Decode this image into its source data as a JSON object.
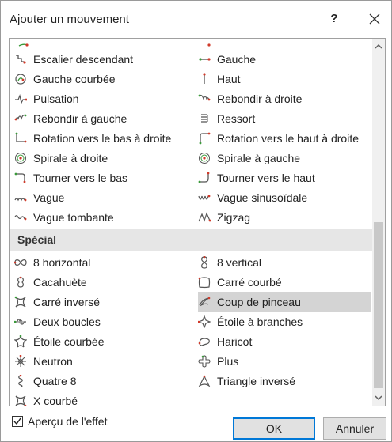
{
  "dialog": {
    "title": "Ajouter un mouvement",
    "help_label": "?",
    "close_icon": "close-icon"
  },
  "list": {
    "rows_before": [
      {
        "left": {
          "label": "Escalier descendant",
          "icon": "stairs-down-icon"
        },
        "right": {
          "label": "Gauche",
          "icon": "arrow-left-icon"
        }
      },
      {
        "left": {
          "label": "Gauche courbée",
          "icon": "curved-left-icon"
        },
        "right": {
          "label": "Haut",
          "icon": "arrow-up-icon"
        }
      },
      {
        "left": {
          "label": "Pulsation",
          "icon": "pulse-icon"
        },
        "right": {
          "label": "Rebondir à droite",
          "icon": "bounce-right-icon"
        }
      },
      {
        "left": {
          "label": "Rebondir à gauche",
          "icon": "bounce-left-icon"
        },
        "right": {
          "label": "Ressort",
          "icon": "spring-icon"
        }
      },
      {
        "left": {
          "label": "Rotation vers le bas à droite",
          "icon": "turn-down-right-icon"
        },
        "right": {
          "label": "Rotation vers le haut à droite",
          "icon": "turn-up-right-icon"
        }
      },
      {
        "left": {
          "label": "Spirale à droite",
          "icon": "spiral-right-icon"
        },
        "right": {
          "label": "Spirale à gauche",
          "icon": "spiral-left-icon"
        }
      },
      {
        "left": {
          "label": "Tourner vers le bas",
          "icon": "turn-down-icon"
        },
        "right": {
          "label": "Tourner vers le haut",
          "icon": "turn-up-icon"
        }
      },
      {
        "left": {
          "label": "Vague",
          "icon": "wave-icon"
        },
        "right": {
          "label": "Vague sinusoïdale",
          "icon": "sine-wave-icon"
        }
      },
      {
        "left": {
          "label": "Vague tombante",
          "icon": "falling-wave-icon"
        },
        "right": {
          "label": "Zigzag",
          "icon": "zigzag-icon"
        }
      }
    ],
    "section_label": "Spécial",
    "rows_after": [
      {
        "left": {
          "label": "8 horizontal",
          "icon": "horizontal-eight-icon"
        },
        "right": {
          "label": "8 vertical",
          "icon": "vertical-eight-icon"
        }
      },
      {
        "left": {
          "label": "Cacahuète",
          "icon": "peanut-icon"
        },
        "right": {
          "label": "Carré courbé",
          "icon": "curved-square-icon"
        }
      },
      {
        "left": {
          "label": "Carré inversé",
          "icon": "inverted-square-icon"
        },
        "right": {
          "label": "Coup de pinceau",
          "icon": "brush-stroke-icon",
          "selected": true
        }
      },
      {
        "left": {
          "label": "Deux boucles",
          "icon": "two-loops-icon"
        },
        "right": {
          "label": "Étoile à branches",
          "icon": "branch-star-icon"
        }
      },
      {
        "left": {
          "label": "Étoile courbée",
          "icon": "curved-star-icon"
        },
        "right": {
          "label": "Haricot",
          "icon": "bean-icon"
        }
      },
      {
        "left": {
          "label": "Neutron",
          "icon": "neutron-icon"
        },
        "right": {
          "label": "Plus",
          "icon": "plus-shape-icon"
        }
      },
      {
        "left": {
          "label": "Quatre 8",
          "icon": "four-eights-icon"
        },
        "right": {
          "label": "Triangle inversé",
          "icon": "inverted-triangle-icon"
        }
      },
      {
        "left": {
          "label": "X courbé",
          "icon": "curved-x-icon"
        },
        "right": null
      }
    ]
  },
  "footer": {
    "preview_label": "Aperçu de l'effet",
    "preview_checked": true,
    "ok_label": "OK",
    "cancel_label": "Annuler"
  },
  "colors": {
    "path_green": "#3a9a3a",
    "path_red": "#d03a2a",
    "icon_gray": "#555555",
    "selection": "#d4d4d4",
    "accent": "#0078d7"
  }
}
